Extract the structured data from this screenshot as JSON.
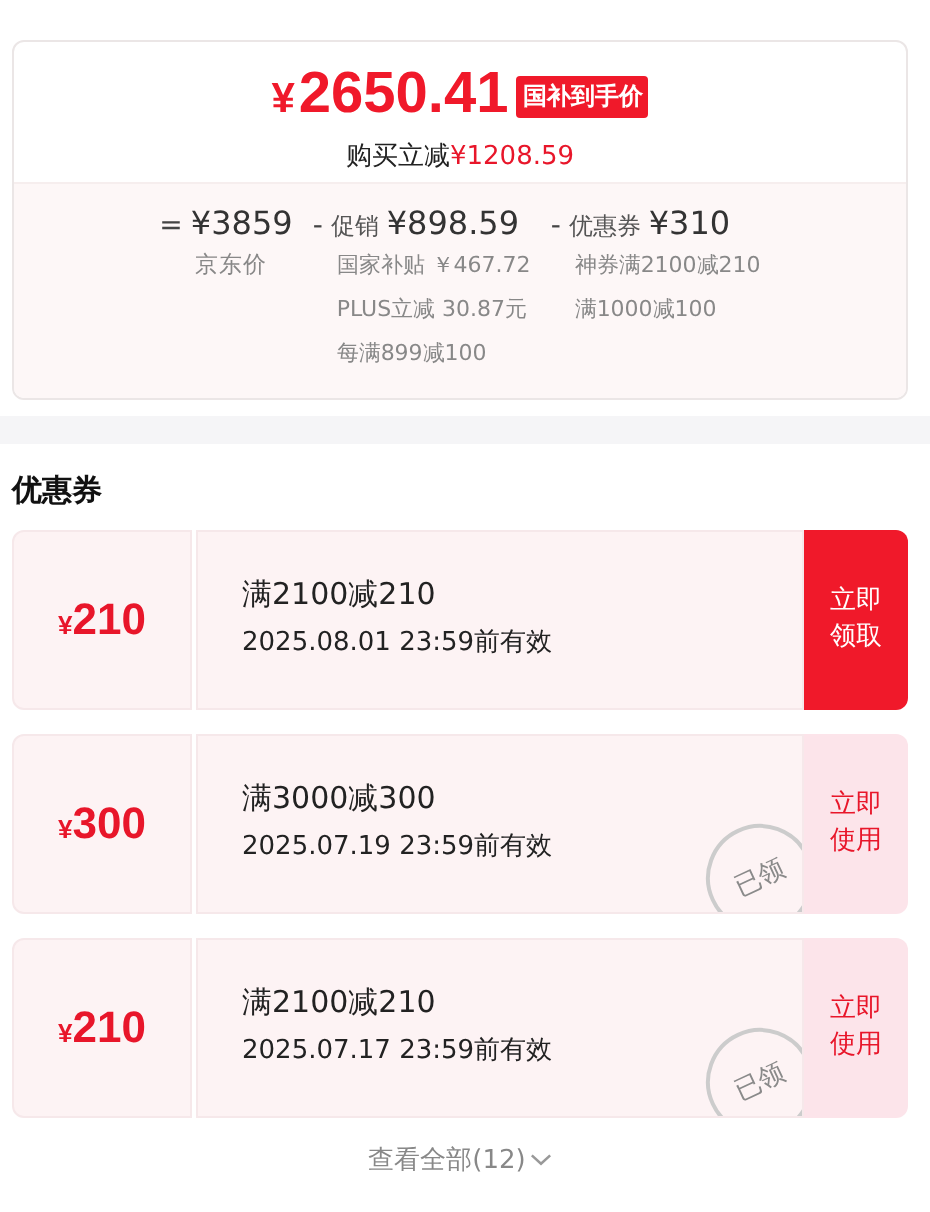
{
  "price_card": {
    "currency": "¥",
    "final_price": "2650.41",
    "price_tag": "国补到手价",
    "saving_label": "购买立减",
    "saving_amount": "¥1208.59",
    "breakdown": [
      {
        "operator": "=",
        "amount": "¥3859",
        "caption": "京东价"
      },
      {
        "operator": "-",
        "label": "促销",
        "amount": "¥898.59",
        "details": [
          "国家补贴 ￥467.72",
          "PLUS立减 30.87元",
          "每满899减100"
        ]
      },
      {
        "operator": "-",
        "label": "优惠券",
        "amount": "¥310",
        "details": [
          "神券满2100减210",
          "满1000减100"
        ]
      }
    ]
  },
  "coupons_section": {
    "title": "优惠券",
    "coupons": [
      {
        "currency": "¥",
        "value": "210",
        "condition": "满2100减210",
        "validity": "2025.08.01 23:59前有效",
        "action": "立即领取",
        "claimed": false
      },
      {
        "currency": "¥",
        "value": "300",
        "condition": "满3000减300",
        "validity": "2025.07.19 23:59前有效",
        "action": "立即使用",
        "claimed": true,
        "stamp": "已领"
      },
      {
        "currency": "¥",
        "value": "210",
        "condition": "满2100减210",
        "validity": "2025.07.17 23:59前有效",
        "action": "立即使用",
        "claimed": true,
        "stamp": "已领"
      }
    ],
    "view_all": "查看全部(12)"
  }
}
